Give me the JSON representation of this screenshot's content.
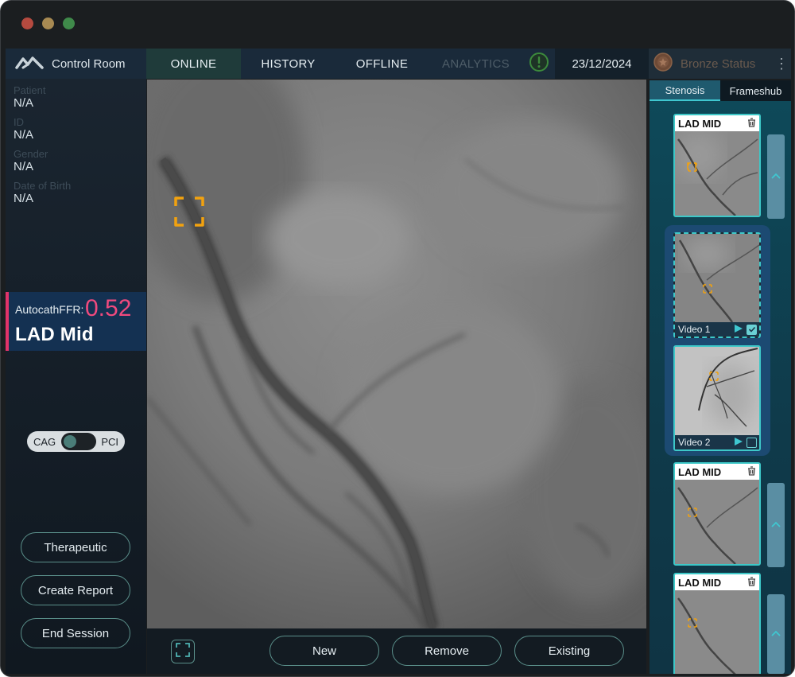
{
  "app": {
    "title": "Control Room",
    "colors": {
      "accent": "#3dc8c8",
      "ffr_value": "#f04a7e",
      "alert": "#3c8a3c",
      "panel": "#143152"
    }
  },
  "nav": {
    "tabs": [
      {
        "label": "ONLINE",
        "state": "active"
      },
      {
        "label": "HISTORY",
        "state": "normal"
      },
      {
        "label": "OFFLINE",
        "state": "normal"
      },
      {
        "label": "ANALYTICS",
        "state": "disabled"
      }
    ],
    "date": "23/12/2024",
    "status": "Bronze Status",
    "icons": {
      "logo": "mountains-logo-icon",
      "alert": "exclamation-circle-icon",
      "medal": "bronze-medal-icon",
      "more": "vertical-dots-icon"
    }
  },
  "patient": {
    "fields": [
      {
        "label": "Patient",
        "value": "N/A"
      },
      {
        "label": "ID",
        "value": "N/A"
      },
      {
        "label": "Gender",
        "value": "N/A"
      },
      {
        "label": "Date of Birth",
        "value": "N/A"
      }
    ]
  },
  "ffr": {
    "label": "AutocathFFR:",
    "value": "0.52",
    "vessel": "LAD Mid"
  },
  "mode_toggle": {
    "left": "CAG",
    "right": "PCI",
    "selected": "CAG"
  },
  "actions": {
    "therapeutic": "Therapeutic",
    "create_report": "Create Report",
    "end_session": "End Session"
  },
  "bottom_bar": {
    "new": "New",
    "remove": "Remove",
    "existing": "Existing"
  },
  "right_panel": {
    "tabs": [
      {
        "label": "Stenosis",
        "state": "active"
      },
      {
        "label": "Frameshub",
        "state": "inactive"
      }
    ],
    "lesions": [
      {
        "label": "LAD MID"
      },
      {
        "label": "LAD MID"
      },
      {
        "label": "LAD MID"
      }
    ],
    "videos": [
      {
        "label": "Video 1",
        "checked": true
      },
      {
        "label": "Video 2",
        "checked": false
      }
    ]
  }
}
